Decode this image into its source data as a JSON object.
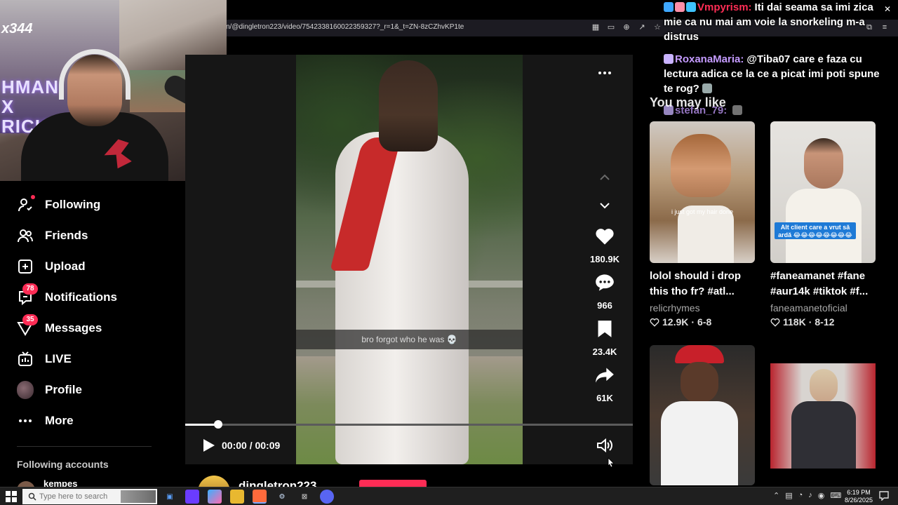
{
  "browser": {
    "url": "n/@dingletron223/video/7542338160022359327?_r=1&_t=ZN-8zCZhvKP1te"
  },
  "webcam": {
    "badge": "x344",
    "poster_text": "HMAN\nX\nRICK"
  },
  "chat": {
    "messages": [
      {
        "user": "Vmpyrism:",
        "user_color": "#ff2d55",
        "text": "Iti dai seama sa imi zica mie ca nu mai am voie la snorkeling m-a distrus"
      },
      {
        "user": "RoxanaMaria:",
        "user_color": "#b07cff",
        "text": "@Tiba07 care e faza cu lectura adica ce la ce a picat imi poti spune te rog?"
      },
      {
        "user": "stefan_79:",
        "user_color": "#b07cff",
        "text": ""
      }
    ]
  },
  "sidebar": {
    "items": [
      {
        "label": "Following",
        "icon": "following-icon"
      },
      {
        "label": "Friends",
        "icon": "friends-icon"
      },
      {
        "label": "Upload",
        "icon": "upload-icon"
      },
      {
        "label": "Notifications",
        "icon": "notifications-icon",
        "badge": "78"
      },
      {
        "label": "Messages",
        "icon": "messages-icon",
        "badge": "35"
      },
      {
        "label": "LIVE",
        "icon": "live-icon"
      },
      {
        "label": "Profile",
        "icon": "profile-avatar"
      },
      {
        "label": "More",
        "icon": "more-icon"
      }
    ],
    "following_title": "Following accounts",
    "following_first": "kempes"
  },
  "video": {
    "caption": "bro forgot who he was 💀",
    "time": "00:00 / 00:09",
    "progress_fraction": 0.07,
    "author": "dingletron223",
    "likes": "180.9K",
    "comments": "966",
    "saves": "23.4K",
    "shares": "61K"
  },
  "you_may_like": {
    "title": "You may like",
    "cards": [
      {
        "title": "lolol should i drop this tho fr? #atl...",
        "author": "relicrhymes",
        "likes": "12.9K",
        "age": "6-8",
        "thumb_caption": "i just got my hair done"
      },
      {
        "title": "#faneamanet #fane #aur14k #tiktok #f...",
        "author": "faneamanetoficial",
        "likes": "118K",
        "age": "8-12",
        "thumb_caption": "Alt client care a vrut să ardă 😂😂😂😂😂😂😂😂😂"
      }
    ]
  },
  "taskbar": {
    "search_placeholder": "Type here to search",
    "time": "6:19 PM",
    "date": "8/26/2025"
  },
  "colors": {
    "accent": "#fe2c55",
    "background": "#000000"
  }
}
